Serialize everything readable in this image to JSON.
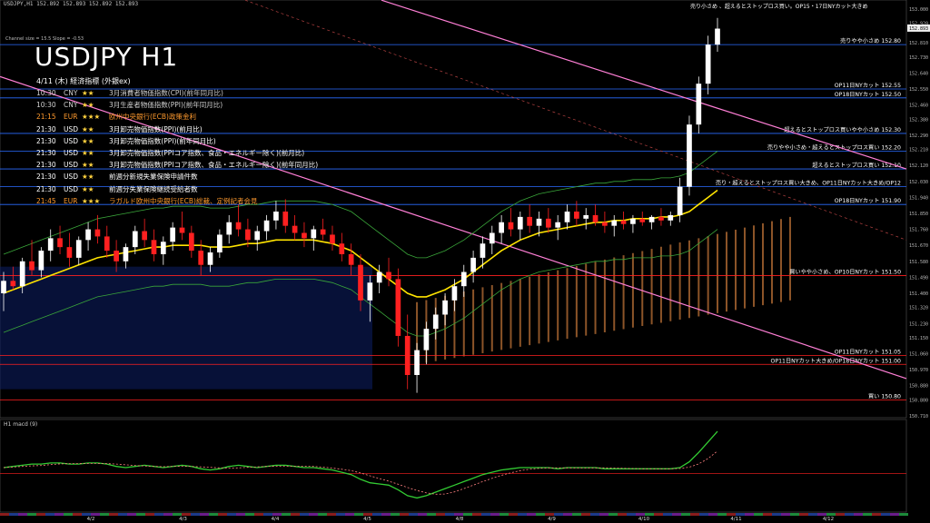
{
  "header": {
    "symbol_line": "USDJPY,H1  152.892 152.893 152.892 152.893"
  },
  "channel_info": "Channel size = 15.5 Slope = -0.53",
  "title": "USDJPY H1",
  "events_header": "4/11 (木) 経済指標 (外銀ex)",
  "events": [
    {
      "time": "10:30",
      "cur": "CNY",
      "stars": "★★",
      "name": "3月消費者物価指数(CPI)(前年同月比)",
      "color": "#cfcfcf"
    },
    {
      "time": "10:30",
      "cur": "CNY",
      "stars": "★★",
      "name": "3月生産者物価指数(PPI)(前年同月比)",
      "color": "#cfcfcf"
    },
    {
      "time": "21:15",
      "cur": "EUR",
      "stars": "★★★",
      "name": "欧州中央銀行(ECB)政策金利",
      "color": "#ff9a2e"
    },
    {
      "time": "21:30",
      "cur": "USD",
      "stars": "★★",
      "name": "3月卸売物価指数(PPI)(前月比)",
      "color": "#ffffff"
    },
    {
      "time": "21:30",
      "cur": "USD",
      "stars": "★★",
      "name": "3月卸売物価指数(PPI)(前年同月比)",
      "color": "#ffffff"
    },
    {
      "time": "21:30",
      "cur": "USD",
      "stars": "★★",
      "name": "3月卸売物価指数(PPIコア指数、食品・エネルギー除く)(前月比)",
      "color": "#ffffff"
    },
    {
      "time": "21:30",
      "cur": "USD",
      "stars": "★★",
      "name": "3月卸売物価指数(PPIコア指数、食品・エネルギー除く)(前年同月比)",
      "color": "#ffffff"
    },
    {
      "time": "21:30",
      "cur": "USD",
      "stars": "★★",
      "name": "前週分新規失業保険申請件数",
      "color": "#ffffff"
    },
    {
      "time": "21:30",
      "cur": "USD",
      "stars": "★★",
      "name": "前週分失業保険継続受給者数",
      "color": "#ffffff"
    },
    {
      "time": "21:45",
      "cur": "EUR",
      "stars": "★★★",
      "name": "ラガルド欧州中央銀行(ECB)総裁、定例記者会見",
      "color": "#ff9a2e"
    }
  ],
  "macd_label": "H1  macd (9)",
  "top_right_note": "売り小さめ 、超えるとストップロス買い。OP15・17日NYカット大きめ",
  "colors": {
    "bull": "#ffffff",
    "bear": "#ff2020",
    "level_blue": "#2a6cff",
    "level_red": "#ff2020",
    "trend": "#ff7fd6",
    "sma": "#ffe400",
    "cloud": "#ff9a4a"
  },
  "chart_data": {
    "type": "candlestick",
    "x_ticks": [
      "4/2",
      "4/3",
      "4/4",
      "4/5",
      "4/8",
      "4/9",
      "4/10",
      "4/11",
      "4/12"
    ],
    "y_ticks": [
      "153.000",
      "152.920",
      "152.810",
      "152.730",
      "152.640",
      "152.550",
      "152.460",
      "152.380",
      "152.290",
      "152.210",
      "152.120",
      "152.030",
      "151.940",
      "151.850",
      "151.760",
      "151.670",
      "151.580",
      "151.490",
      "151.400",
      "151.320",
      "151.230",
      "151.150",
      "151.060",
      "150.970",
      "150.880",
      "150.800",
      "150.710"
    ],
    "ylim": [
      150.71,
      153.0
    ],
    "current_price": "152.893",
    "levels": [
      {
        "price": 152.8,
        "label": "売りやや小さめ 152.80",
        "color": "blue"
      },
      {
        "price": 152.55,
        "label": "OP11日NYカット 152.55",
        "color": "blue"
      },
      {
        "price": 152.5,
        "label": "OP18日NYカット 152.50",
        "color": "blue"
      },
      {
        "price": 152.3,
        "label": "超えるとストップロス買いやや小さめ 152.30",
        "color": "blue"
      },
      {
        "price": 152.2,
        "label": "売りやや小さめ・超えるとストップロス買い 152.20",
        "color": "blue"
      },
      {
        "price": 152.1,
        "label": "超えるとストップロス買い 152.10",
        "color": "blue"
      },
      {
        "price": 152.0,
        "label": "売り・超えるとストップロス買い大きめ、OP11日NYカット大きめ/OP12",
        "color": "blue"
      },
      {
        "price": 151.9,
        "label": "OP18日NYカット 151.90",
        "color": "blue"
      },
      {
        "price": 151.5,
        "label": "買いやや小さめ、OP10日NYカット 151.50",
        "color": "red"
      },
      {
        "price": 151.05,
        "label": "OP11日NYカット 151.05",
        "color": "red"
      },
      {
        "price": 151.0,
        "label": "OP11日NYカット大きめ/OP18日NYカット 151.00",
        "color": "red"
      },
      {
        "price": 150.8,
        "label": "買い 150.80",
        "color": "red"
      }
    ],
    "candles": [
      [
        151.4,
        151.52,
        151.3,
        151.47
      ],
      [
        151.47,
        151.55,
        151.42,
        151.44
      ],
      [
        151.44,
        151.6,
        151.4,
        151.58
      ],
      [
        151.58,
        151.7,
        151.5,
        151.53
      ],
      [
        151.53,
        151.66,
        151.49,
        151.64
      ],
      [
        151.64,
        151.76,
        151.58,
        151.71
      ],
      [
        151.71,
        151.78,
        151.62,
        151.66
      ],
      [
        151.66,
        151.74,
        151.55,
        151.6
      ],
      [
        151.6,
        151.72,
        151.56,
        151.7
      ],
      [
        151.7,
        151.8,
        151.64,
        151.76
      ],
      [
        151.76,
        151.84,
        151.68,
        151.72
      ],
      [
        151.72,
        151.78,
        151.6,
        151.64
      ],
      [
        151.64,
        151.7,
        151.52,
        151.58
      ],
      [
        151.58,
        151.68,
        151.54,
        151.66
      ],
      [
        151.66,
        151.78,
        151.62,
        151.75
      ],
      [
        151.75,
        151.82,
        151.66,
        151.7
      ],
      [
        151.7,
        151.76,
        151.58,
        151.62
      ],
      [
        151.62,
        151.72,
        151.56,
        151.69
      ],
      [
        151.69,
        151.8,
        151.64,
        151.77
      ],
      [
        151.77,
        151.86,
        151.7,
        151.74
      ],
      [
        151.74,
        151.78,
        151.6,
        151.64
      ],
      [
        151.64,
        151.7,
        151.5,
        151.56
      ],
      [
        151.56,
        151.66,
        151.52,
        151.63
      ],
      [
        151.63,
        151.76,
        151.6,
        151.73
      ],
      [
        151.73,
        151.84,
        151.68,
        151.8
      ],
      [
        151.8,
        151.9,
        151.72,
        151.76
      ],
      [
        151.76,
        151.82,
        151.66,
        151.7
      ],
      [
        151.7,
        151.78,
        151.64,
        151.75
      ],
      [
        151.75,
        151.84,
        151.7,
        151.81
      ],
      [
        151.81,
        151.92,
        151.76,
        151.86
      ],
      [
        151.86,
        151.93,
        151.74,
        151.78
      ],
      [
        151.78,
        151.84,
        151.7,
        151.74
      ],
      [
        151.74,
        151.8,
        151.66,
        151.71
      ],
      [
        151.71,
        151.78,
        151.64,
        151.76
      ],
      [
        151.76,
        151.82,
        151.7,
        151.73
      ],
      [
        151.73,
        151.78,
        151.64,
        151.68
      ],
      [
        151.68,
        151.74,
        151.58,
        151.62
      ],
      [
        151.62,
        151.68,
        151.5,
        151.56
      ],
      [
        151.56,
        151.62,
        151.3,
        151.36
      ],
      [
        151.36,
        151.5,
        151.24,
        151.46
      ],
      [
        151.46,
        151.56,
        151.4,
        151.52
      ],
      [
        151.52,
        151.6,
        151.44,
        151.48
      ],
      [
        151.48,
        151.54,
        151.1,
        151.16
      ],
      [
        151.16,
        151.28,
        150.86,
        150.94
      ],
      [
        150.94,
        151.12,
        150.84,
        151.08
      ],
      [
        151.08,
        151.24,
        151.0,
        151.2
      ],
      [
        151.2,
        151.32,
        151.14,
        151.28
      ],
      [
        151.28,
        151.4,
        151.22,
        151.36
      ],
      [
        151.36,
        151.48,
        151.3,
        151.44
      ],
      [
        151.44,
        151.56,
        151.38,
        151.52
      ],
      [
        151.52,
        151.64,
        151.46,
        151.6
      ],
      [
        151.6,
        151.72,
        151.54,
        151.68
      ],
      [
        151.68,
        151.78,
        151.62,
        151.74
      ],
      [
        151.74,
        151.84,
        151.68,
        151.8
      ],
      [
        151.8,
        151.88,
        151.72,
        151.76
      ],
      [
        151.76,
        151.86,
        151.7,
        151.83
      ],
      [
        151.83,
        151.9,
        151.74,
        151.78
      ],
      [
        151.78,
        151.86,
        151.72,
        151.82
      ],
      [
        151.82,
        151.88,
        151.74,
        151.77
      ],
      [
        151.77,
        151.84,
        151.7,
        151.8
      ],
      [
        151.8,
        151.9,
        151.76,
        151.86
      ],
      [
        151.86,
        151.92,
        151.78,
        151.82
      ],
      [
        151.82,
        151.88,
        151.76,
        151.84
      ],
      [
        151.84,
        151.9,
        151.78,
        151.8
      ],
      [
        151.8,
        151.86,
        151.74,
        151.78
      ],
      [
        151.78,
        151.84,
        151.72,
        151.81
      ],
      [
        151.81,
        151.86,
        151.76,
        151.79
      ],
      [
        151.79,
        151.84,
        151.74,
        151.82
      ],
      [
        151.82,
        151.86,
        151.78,
        151.8
      ],
      [
        151.8,
        151.84,
        151.76,
        151.83
      ],
      [
        151.83,
        151.88,
        151.78,
        151.81
      ],
      [
        151.81,
        151.86,
        151.78,
        151.84
      ],
      [
        151.84,
        152.05,
        151.8,
        152.0
      ],
      [
        152.0,
        152.4,
        151.95,
        152.35
      ],
      [
        152.35,
        152.62,
        152.3,
        152.58
      ],
      [
        152.58,
        152.85,
        152.52,
        152.8
      ],
      [
        152.8,
        152.95,
        152.76,
        152.89
      ]
    ],
    "sma": [
      151.4,
      151.42,
      151.44,
      151.46,
      151.48,
      151.5,
      151.52,
      151.54,
      151.56,
      151.58,
      151.6,
      151.61,
      151.62,
      151.63,
      151.64,
      151.65,
      151.66,
      151.66,
      151.67,
      151.67,
      151.67,
      151.67,
      151.66,
      151.66,
      151.66,
      151.67,
      151.68,
      151.68,
      151.69,
      151.7,
      151.7,
      151.7,
      151.7,
      151.7,
      151.69,
      151.68,
      151.66,
      151.64,
      151.6,
      151.56,
      151.52,
      151.48,
      151.44,
      151.4,
      151.38,
      151.38,
      151.4,
      151.42,
      151.45,
      151.48,
      151.52,
      151.56,
      151.6,
      151.64,
      151.67,
      151.7,
      151.72,
      151.74,
      151.75,
      151.76,
      151.77,
      151.78,
      151.79,
      151.8,
      151.8,
      151.81,
      151.81,
      151.82,
      151.82,
      151.82,
      151.83,
      151.83,
      151.84,
      151.86,
      151.9,
      151.94,
      151.98
    ],
    "macd": [
      0.05,
      0.06,
      0.07,
      0.08,
      0.08,
      0.09,
      0.09,
      0.08,
      0.08,
      0.09,
      0.09,
      0.08,
      0.06,
      0.05,
      0.06,
      0.07,
      0.06,
      0.05,
      0.06,
      0.07,
      0.06,
      0.04,
      0.03,
      0.04,
      0.06,
      0.07,
      0.06,
      0.05,
      0.06,
      0.07,
      0.07,
      0.06,
      0.05,
      0.05,
      0.04,
      0.03,
      0.01,
      -0.01,
      -0.05,
      -0.08,
      -0.09,
      -0.1,
      -0.14,
      -0.19,
      -0.21,
      -0.19,
      -0.16,
      -0.13,
      -0.1,
      -0.07,
      -0.04,
      -0.01,
      0.01,
      0.03,
      0.04,
      0.05,
      0.05,
      0.05,
      0.05,
      0.04,
      0.05,
      0.05,
      0.05,
      0.05,
      0.04,
      0.04,
      0.04,
      0.04,
      0.04,
      0.04,
      0.04,
      0.04,
      0.05,
      0.1,
      0.18,
      0.27,
      0.36
    ],
    "macd_ylim": [
      -0.3,
      0.4
    ]
  }
}
